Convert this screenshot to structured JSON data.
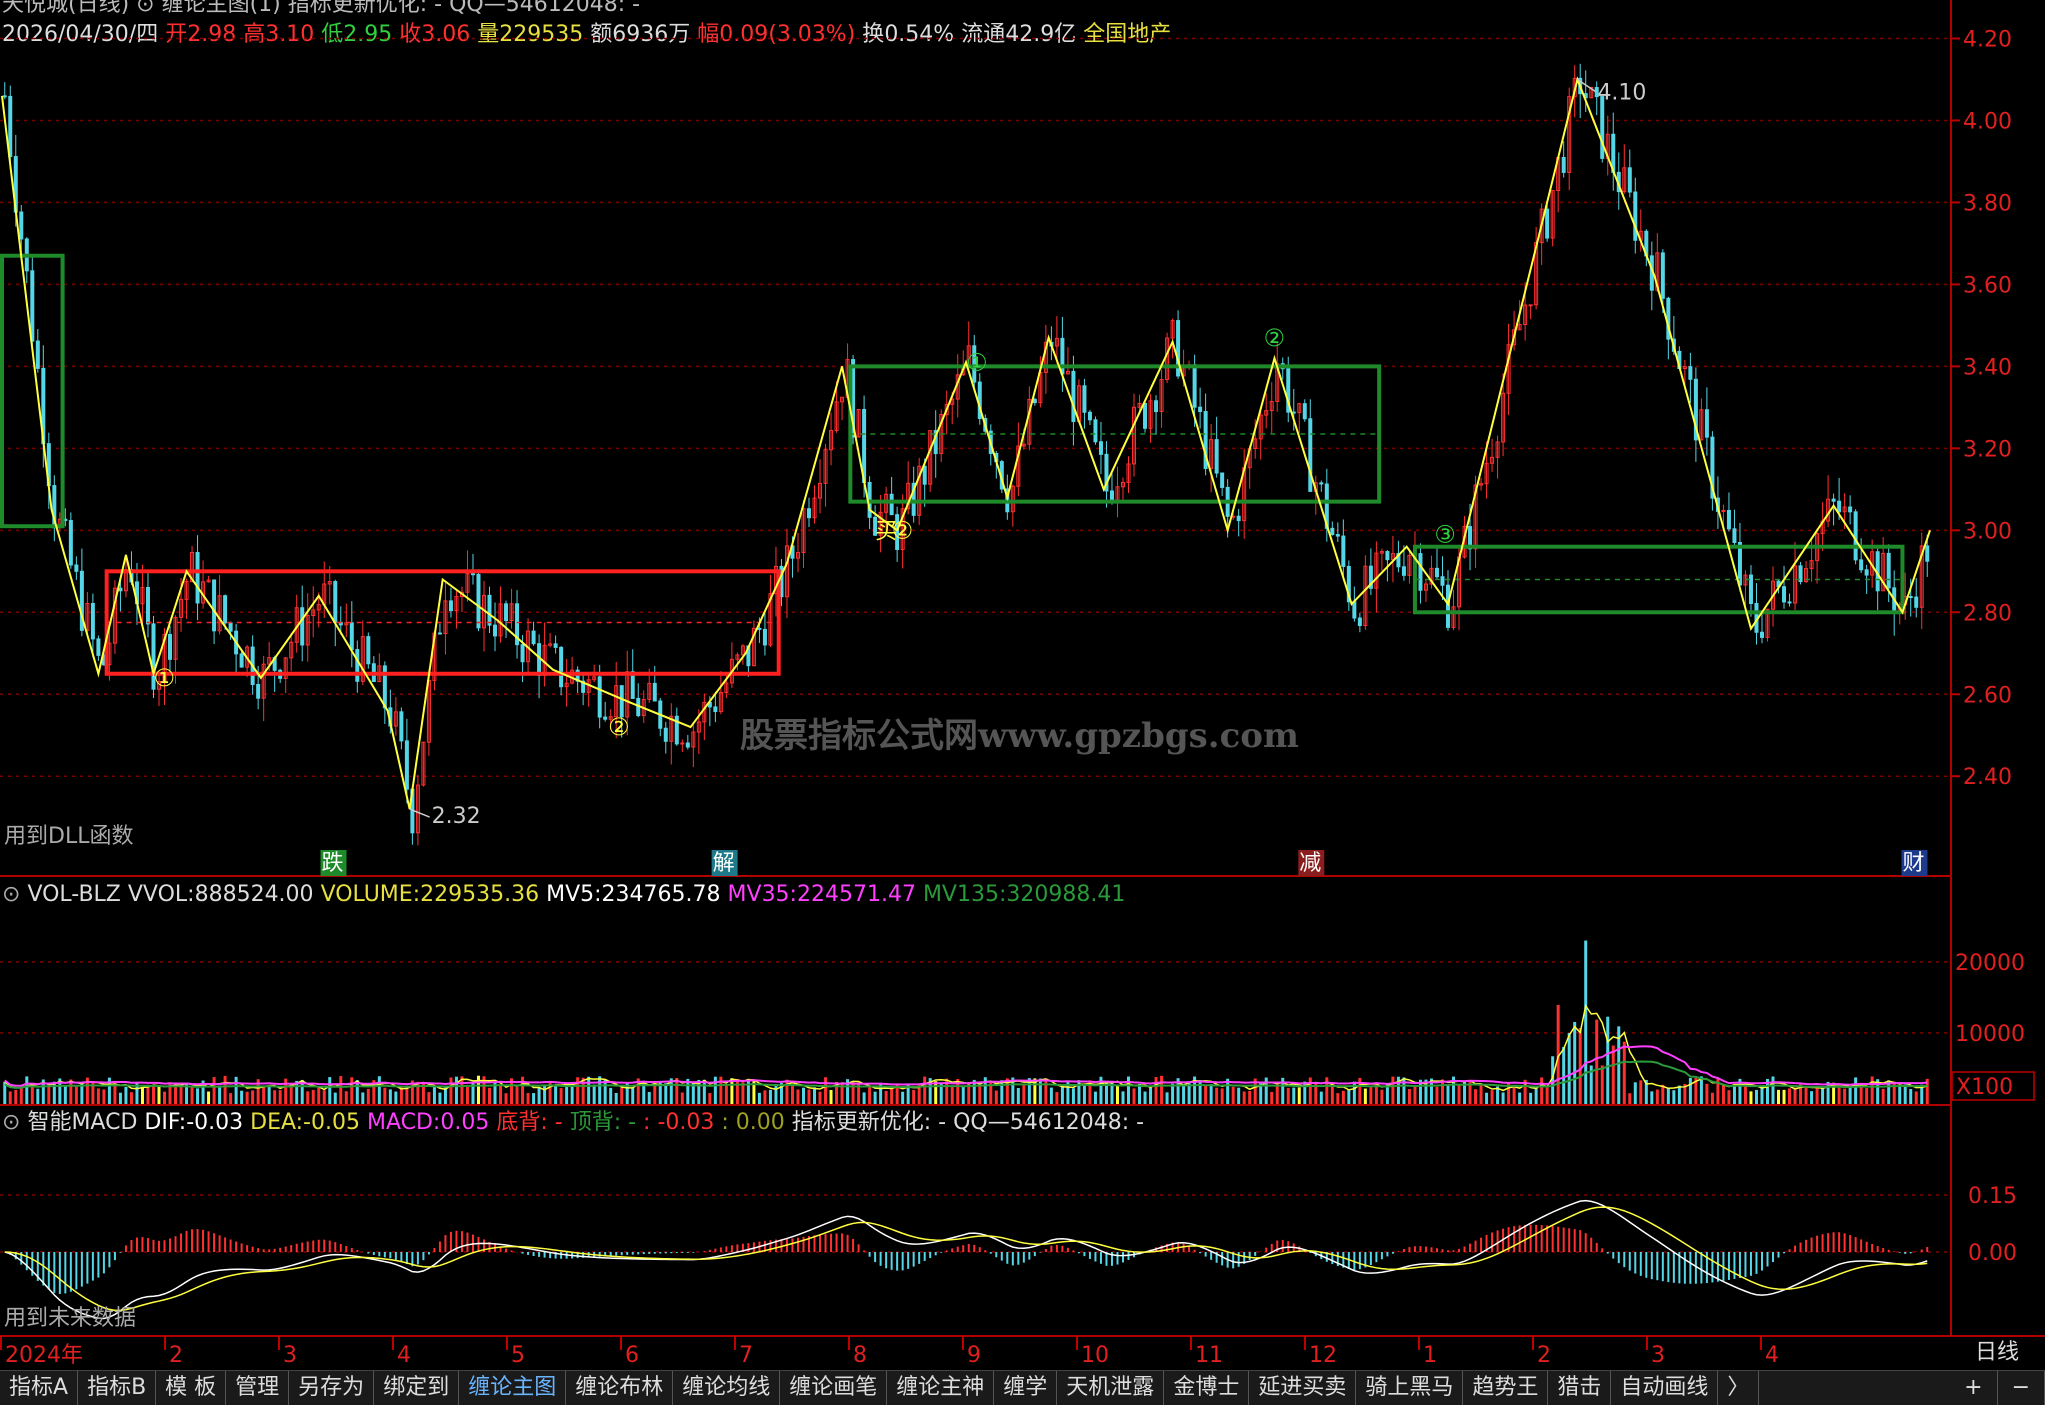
{
  "header": {
    "line1": "天悦城(日线)   ⊙ 缠论主图(1)  指标更新优化: -  QQ—54612048: -",
    "date": "2026/04/30/四",
    "open_label": "开",
    "open": "2.98",
    "high_label": "高",
    "high": "3.10",
    "low_label": "低",
    "low": "2.95",
    "close_label": "收",
    "close": "3.06",
    "vol_label": "量",
    "vol": "229535",
    "amount_label": "额",
    "amount": "6936万",
    "change_label": "幅",
    "change": "0.09(3.03%)",
    "turnover_label": "换",
    "turnover": "0.54%",
    "float_label": "流通",
    "float": "42.9亿",
    "sector": "全国地产"
  },
  "main_panel": {
    "note": "用到DLL函数",
    "watermark": "股票指标公式网www.gpzbgs.com",
    "y_ticks": [
      "4.20",
      "4.00",
      "3.80",
      "3.60",
      "3.40",
      "3.20",
      "3.00",
      "2.80",
      "2.60",
      "2.40"
    ],
    "high_mark": "4.10",
    "low_mark": "2.32",
    "event_labels": [
      "跌",
      "解",
      "减",
      "财"
    ],
    "bi_markers": [
      "①",
      "②",
      "②",
      "①",
      "②",
      "③"
    ],
    "buy_marker": "买"
  },
  "vol_panel": {
    "title": "VOL-BLZ",
    "vvol_label": "VVOL:",
    "vvol": "888524.00",
    "volume_label": "VOLUME:",
    "volume": "229535.36",
    "mv5_label": "MV5:",
    "mv5": "234765.78",
    "mv35_label": "MV35:",
    "mv35": "224571.47",
    "mv135_label": "MV135:",
    "mv135": "320988.41",
    "y_ticks": [
      "20000",
      "10000"
    ],
    "unit": "X100"
  },
  "macd_panel": {
    "title": "智能MACD",
    "dif_label": "DIF:",
    "dif": "-0.03",
    "dea_label": "DEA:",
    "dea": "-0.05",
    "macd_label": "MACD:",
    "macd": "0.05",
    "bottom_div": "底背: -",
    "top_div": "顶背: -",
    "extra1": ": -0.03",
    "extra2": ": 0.00",
    "update": "指标更新优化: -  QQ—54612048: -",
    "note": "用到未来数据",
    "y_ticks": [
      "0.15",
      "0.00"
    ]
  },
  "x_axis": {
    "labels": [
      "2024年",
      "2",
      "3",
      "4",
      "5",
      "6",
      "7",
      "8",
      "9",
      "10",
      "11",
      "12",
      "1",
      "2",
      "3",
      "4"
    ],
    "period": "日线"
  },
  "tabs": [
    "指标A",
    "指标B",
    "模 板",
    "管理",
    "另存为",
    "绑定到",
    "缠论主图",
    "缠论布林",
    "缠论均线",
    "缠论画笔",
    "缠论主神",
    "缠学",
    "天机泄露",
    "金博士",
    "延进买卖",
    "骑上黑马",
    "趋势王",
    "猎击",
    "自动画线"
  ],
  "tab_active_index": 6,
  "tab_more": "〉",
  "corner_buttons": [
    "+",
    "−"
  ],
  "colors": {
    "up": "#ff3030",
    "down": "#54d6e6",
    "zigzag": "#ffff40",
    "box_red": "#ff2020",
    "box_green": "#1e8a2a",
    "axis": "#c00000",
    "mv5": "#ffffff",
    "mv35": "#ff40ff",
    "mv135": "#2a9a3a"
  },
  "chart_data": {
    "type": "candlestick",
    "y_range_price": [
      2.22,
      4.25
    ],
    "price_path": [
      [
        0,
        4.06
      ],
      [
        18,
        3.05
      ],
      [
        35,
        2.65
      ],
      [
        45,
        2.94
      ],
      [
        55,
        2.65
      ],
      [
        67,
        2.9
      ],
      [
        94,
        2.64
      ],
      [
        115,
        2.84
      ],
      [
        140,
        2.56
      ],
      [
        148,
        2.32
      ],
      [
        160,
        2.88
      ],
      [
        180,
        2.78
      ],
      [
        200,
        2.66
      ],
      [
        228,
        2.58
      ],
      [
        250,
        2.52
      ],
      [
        270,
        2.7
      ],
      [
        285,
        2.92
      ],
      [
        305,
        3.4
      ],
      [
        315,
        3.05
      ],
      [
        325,
        3.0
      ],
      [
        350,
        3.41
      ],
      [
        365,
        3.08
      ],
      [
        380,
        3.47
      ],
      [
        400,
        3.1
      ],
      [
        425,
        3.46
      ],
      [
        445,
        3.0
      ],
      [
        462,
        3.42
      ],
      [
        490,
        2.82
      ],
      [
        510,
        2.96
      ],
      [
        525,
        2.82
      ],
      [
        572,
        4.1
      ],
      [
        600,
        3.62
      ],
      [
        635,
        2.76
      ],
      [
        665,
        3.06
      ],
      [
        690,
        2.8
      ],
      [
        700,
        3.0
      ]
    ],
    "boxes": [
      {
        "color": "red",
        "x": [
          38,
          282
        ],
        "y": [
          2.65,
          2.9
        ]
      },
      {
        "color": "green",
        "x": [
          308,
          500
        ],
        "y": [
          3.07,
          3.4
        ]
      },
      {
        "color": "green",
        "x": [
          513,
          690
        ],
        "y": [
          2.8,
          2.96
        ]
      },
      {
        "color": "green",
        "x": [
          0,
          22
        ],
        "y": [
          3.01,
          3.67
        ]
      }
    ],
    "volume_peak_label": "23000"
  }
}
